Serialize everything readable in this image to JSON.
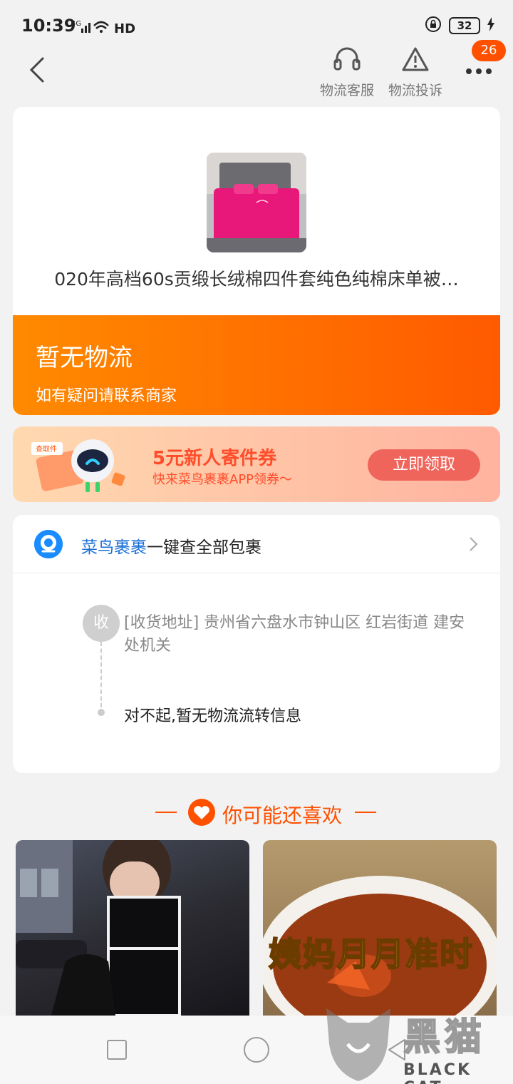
{
  "status_bar": {
    "time": "10:39",
    "network": "4G",
    "hd": "HD",
    "battery": "32"
  },
  "header": {
    "customer_service_label": "物流客服",
    "complaint_label": "物流投诉",
    "more_badge": "26"
  },
  "product": {
    "title": "020年高档60s贡缎长绒棉四件套纯色纯棉床单被…"
  },
  "logistics_status": {
    "title": "暂无物流",
    "subtitle": "如有疑问请联系商家"
  },
  "coupon": {
    "title": "5元新人寄件券",
    "subtitle": "快来菜鸟裹裹APP领券～",
    "button": "立即领取",
    "tag": "查取件"
  },
  "tracking": {
    "brand": "菜鸟裹裹",
    "brand_suffix": "一键查全部包裹",
    "receive_marker": "收",
    "address": "[收货地址] 贵州省六盘水市钟山区 红岩街道   建安处机关",
    "no_info": "对不起,暂无物流流转信息"
  },
  "recommend": {
    "title": "你可能还喜欢",
    "items": [
      {
        "overlay_text": ""
      },
      {
        "overlay_text": "姨妈月月准时"
      }
    ]
  },
  "watermark": {
    "cn": "黑猫",
    "en": "BLACK CAT"
  },
  "colors": {
    "accent": "#ff5000",
    "brand_blue": "#1a6fd6",
    "coupon_red": "#ff4d2b"
  }
}
